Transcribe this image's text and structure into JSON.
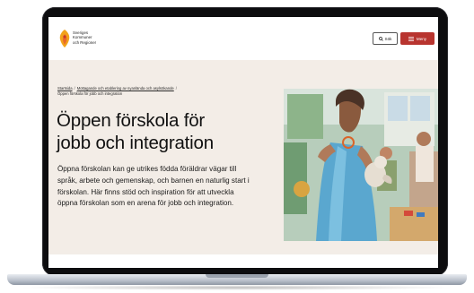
{
  "logo": {
    "icon": "skr-flame-logo-icon",
    "lines": [
      "Sveriges",
      "Kommuner",
      "och Regioner"
    ]
  },
  "header": {
    "search_label": "Sök",
    "menu_label": "Meny",
    "search_icon": "search-icon",
    "menu_icon": "hamburger-icon",
    "accent_color": "#b8342f"
  },
  "breadcrumb": {
    "items": [
      "Startsida",
      "Mottagande och etablering av nyanlända och asylsökande",
      "Öppen förskola för jobb och integration"
    ],
    "separator": "/"
  },
  "hero": {
    "title": "Öppen förskola för jobb och integration",
    "lead": "Öppna förskolan kan ge utrikes födda föräldrar vägar till språk, arbete och gemenskap, och barnen en naturlig start i förskolan. Här finns stöd och inspiration för att utveckla öppna förskolan som en arena för jobb och integration.",
    "background_color": "#f3ede7"
  }
}
